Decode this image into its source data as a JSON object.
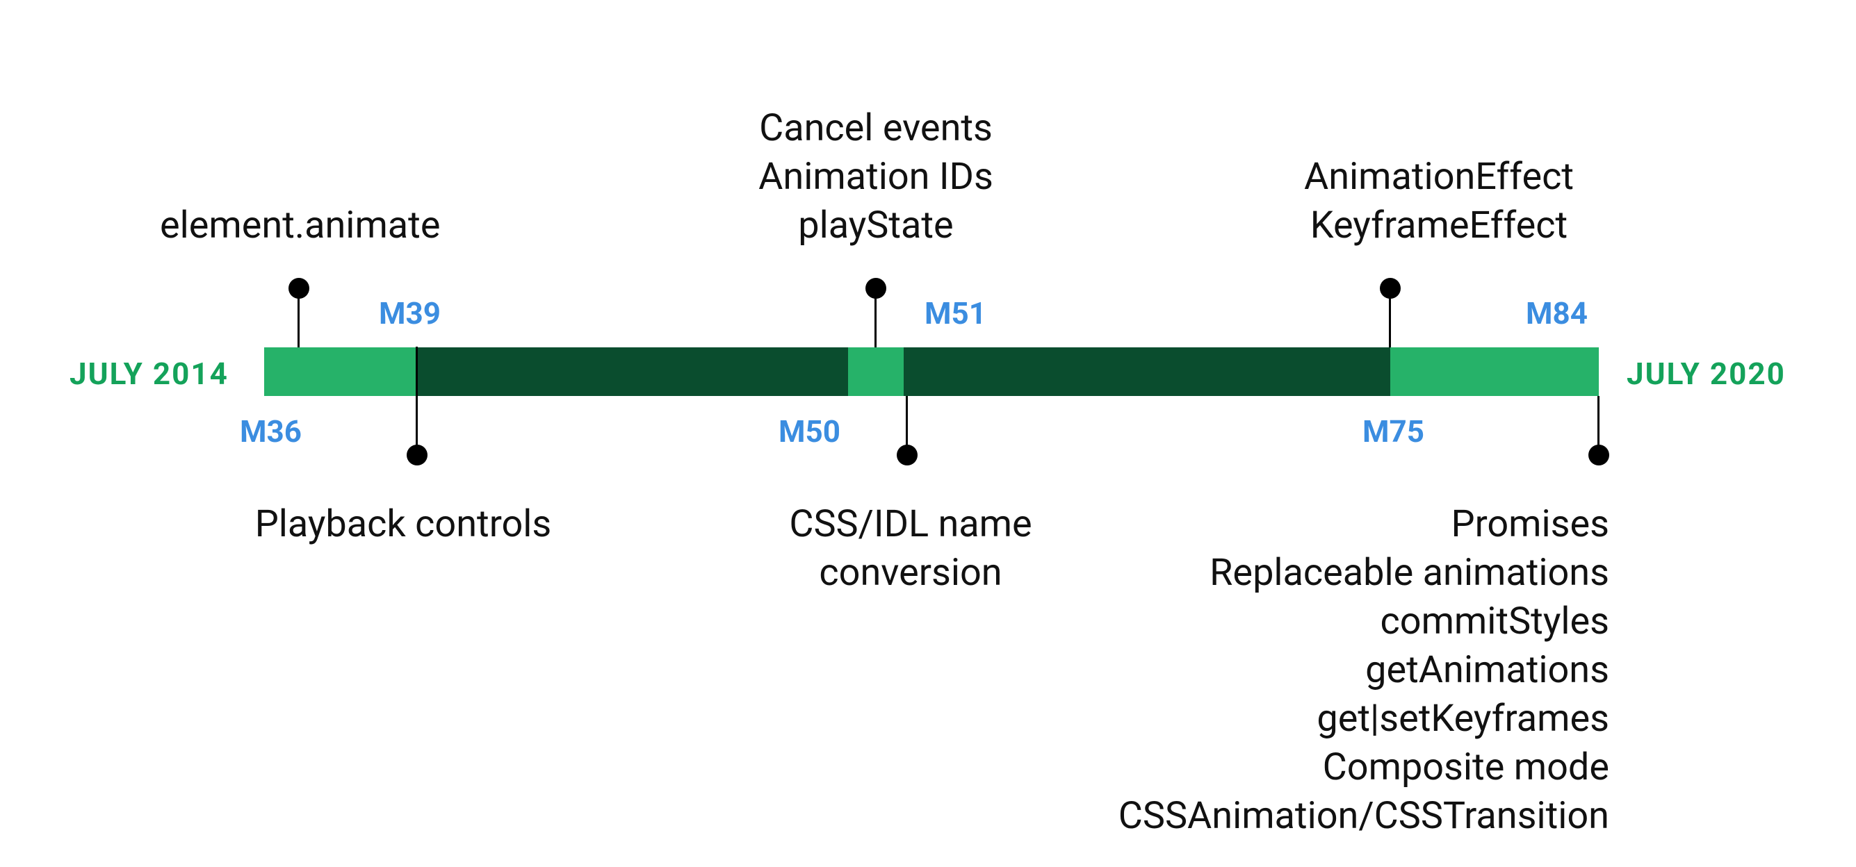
{
  "chart_data": {
    "type": "timeline",
    "title": "",
    "start_label": "JULY 2014",
    "end_label": "JULY 2020",
    "range_years": [
      2014,
      2020
    ],
    "milestones": [
      {
        "version": "M36",
        "position": "above",
        "features": [
          "element.animate"
        ]
      },
      {
        "version": "M39",
        "position": "below",
        "features": [
          "Playback controls"
        ]
      },
      {
        "version": "M50",
        "position": "below",
        "features": [
          "CSS/IDL name",
          "conversion"
        ]
      },
      {
        "version": "M51",
        "position": "above",
        "features": [
          "Cancel events",
          "Animation IDs",
          "playState"
        ]
      },
      {
        "version": "M75",
        "position": "above",
        "features": [
          "AnimationEffect",
          "KeyframeEffect"
        ]
      },
      {
        "version": "M84",
        "position": "below",
        "features": [
          "Promises",
          "Replaceable animations",
          "commitStyles",
          "getAnimations",
          "get|setKeyframes",
          "Composite mode",
          "CSSAnimation/CSSTransition"
        ]
      }
    ],
    "bar_colors": {
      "light": "#26b269",
      "dark": "#0a4d2e"
    }
  },
  "dates": {
    "start": "JULY 2014",
    "end": "JULY 2020"
  },
  "versions": {
    "m36": "M36",
    "m39": "M39",
    "m50": "M50",
    "m51": "M51",
    "m75": "M75",
    "m84": "M84"
  },
  "features": {
    "m36_1": "element.animate",
    "m39_1": "Playback controls",
    "m50_1": "CSS/IDL name",
    "m50_2": "conversion",
    "m51_1": "Cancel events",
    "m51_2": "Animation IDs",
    "m51_3": "playState",
    "m75_1": "AnimationEffect",
    "m75_2": "KeyframeEffect",
    "m84_1": "Promises",
    "m84_2": "Replaceable animations",
    "m84_3": "commitStyles",
    "m84_4": "getAnimations",
    "m84_5": "get|setKeyframes",
    "m84_6": "Composite mode",
    "m84_7": "CSSAnimation/CSSTransition"
  }
}
